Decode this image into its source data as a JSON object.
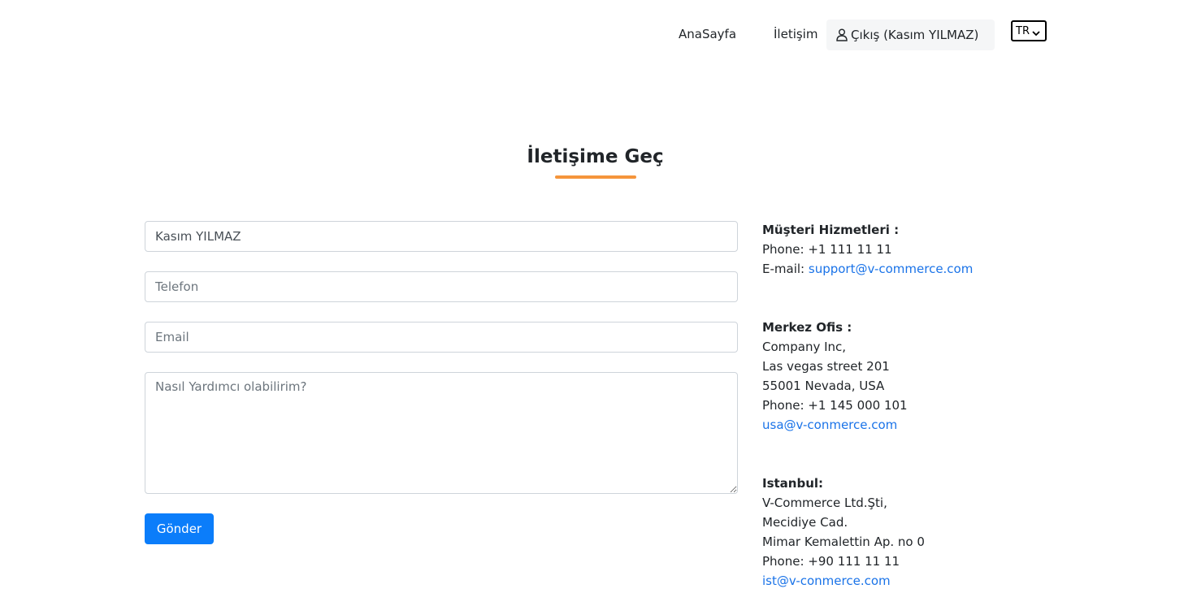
{
  "nav": {
    "home": "AnaSayfa",
    "contact": "İletişim",
    "logout": "Çıkış (Kasım YILMAZ)",
    "language": "TR"
  },
  "page": {
    "title": "İletişime Geç",
    "accent_color": "#f5953b"
  },
  "form": {
    "name_value": "Kasım YILMAZ",
    "phone_placeholder": "Telefon",
    "email_placeholder": "Email",
    "message_placeholder": "Nasıl Yardımcı olabilirim?",
    "submit_label": "Gönder",
    "submit_color": "#0b7dfa"
  },
  "customer_service": {
    "heading": "Müşteri Hizmetleri :",
    "phone_label": "Phone:",
    "phone": "+1 111 11 11",
    "email_label": "E-mail:",
    "email": "support@v-commerce.com"
  },
  "headquarters": {
    "heading": "Merkez Ofis :",
    "lines": [
      "Company Inc,",
      "Las vegas street 201",
      "55001 Nevada, USA",
      "Phone: +1 145 000 101"
    ],
    "email": "usa@v-conmerce.com"
  },
  "istanbul": {
    "heading": "Istanbul:",
    "lines": [
      "V-Commerce Ltd.Şti,",
      "Mecidiye Cad.",
      "Mimar Kemalettin Ap. no 0",
      "Phone: +90 111 11 11"
    ],
    "email": "ist@v-conmerce.com"
  }
}
